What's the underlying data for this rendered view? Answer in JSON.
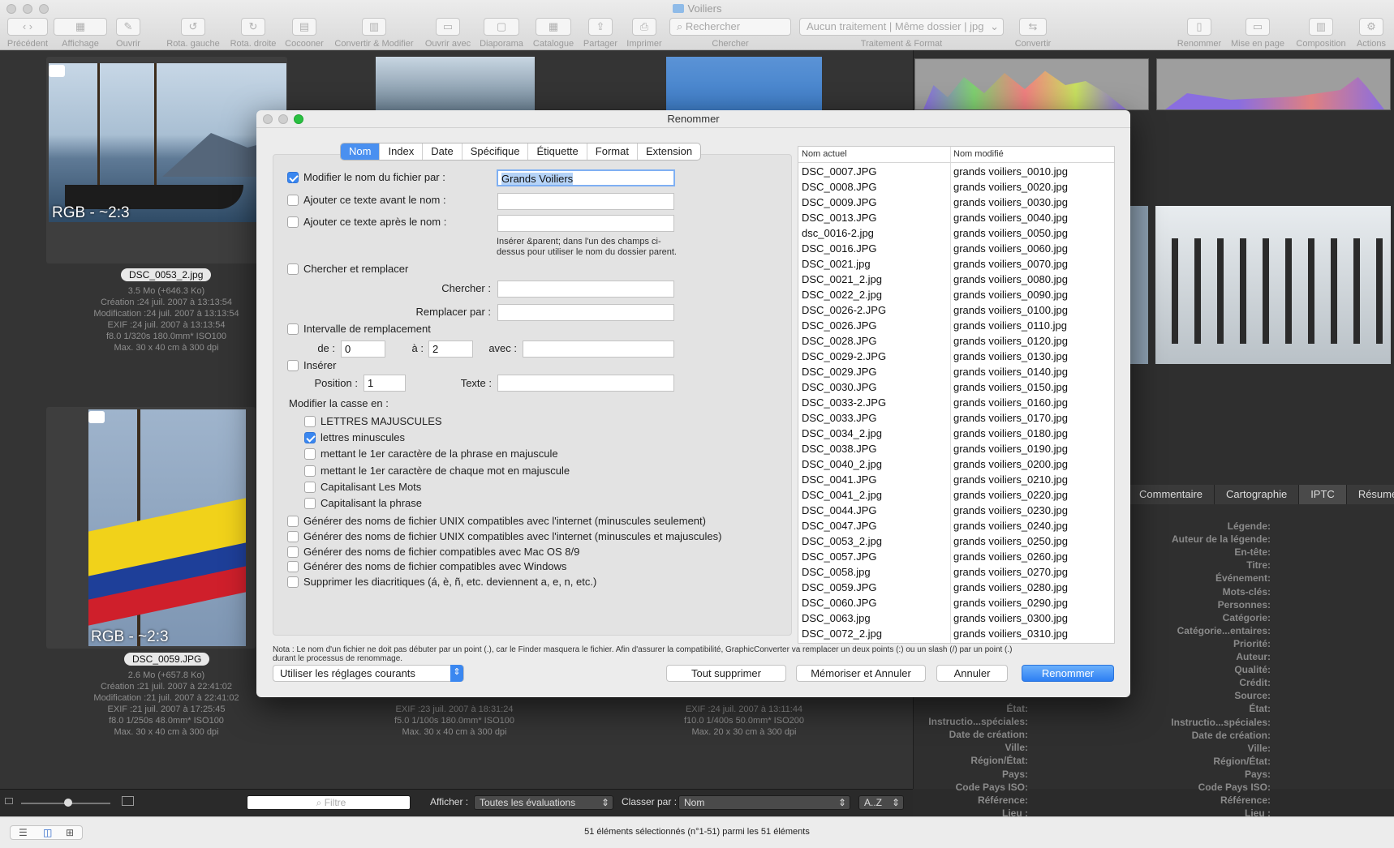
{
  "window": {
    "title": "Voiliers"
  },
  "toolbar": {
    "items": [
      {
        "label": "Précédent",
        "icon": "‹ ›"
      },
      {
        "label": "Affichage",
        "icon": "▦"
      },
      {
        "label": "Ouvrir",
        "icon": "✎"
      },
      {
        "label": "Rota. gauche",
        "icon": "↺"
      },
      {
        "label": "Rota. droite",
        "icon": "↻"
      },
      {
        "label": "Cocooner",
        "icon": "▤"
      },
      {
        "label": "Convertir & Modifier",
        "icon": "▥"
      },
      {
        "label": "Ouvrir avec",
        "icon": "▭"
      },
      {
        "label": "Diaporama",
        "icon": "▢"
      },
      {
        "label": "Catalogue",
        "icon": "▦"
      },
      {
        "label": "Partager",
        "icon": "⇪"
      },
      {
        "label": "Imprimer",
        "icon": "⎙"
      }
    ],
    "search_placeholder": "Rechercher",
    "search_label": "Chercher",
    "process_value": "Aucun traitement | Même dossier | jpg",
    "process_label": "Traitement & Format",
    "convert_label": "Convertir",
    "right_items": [
      {
        "label": "Renommer",
        "icon": "▯"
      },
      {
        "label": "Mise en page",
        "icon": "▭"
      },
      {
        "label": "Composition",
        "icon": "▥"
      },
      {
        "label": "Actions",
        "icon": "⚙"
      }
    ]
  },
  "thumbs": [
    {
      "overlay": "RGB - ~2:3",
      "filename": "DSC_0053_2.jpg",
      "meta": [
        "3.5  Mo (+646.3 Ko)",
        "Création :24 juil. 2007 à 13:13:54",
        "Modification :24 juil. 2007 à 13:13:54",
        "EXIF :24 juil. 2007 à 13:13:54",
        "f8.0 1/320s 180.0mm* ISO100",
        "Max. 30 x 40 cm à 300 dpi"
      ]
    },
    {
      "overlay": "RGB - ~2:3",
      "filename": "DSC_0059.JPG",
      "meta": [
        "2.6  Mo (+657.8 Ko)",
        "Création :21 juil. 2007 à 22:41:02",
        "Modification :21 juil. 2007 à 22:41:02",
        "EXIF :21 juil. 2007 à 17:25:45",
        "f8.0 1/250s 48.0mm* ISO100",
        "Max. 30 x 40 cm à 300 dpi"
      ]
    },
    {
      "meta": [
        "EXIF :23 juil. 2007 à 18:31:24",
        "f5.0 1/100s 180.0mm* ISO100",
        "Max. 30 x 40 cm à 300 dpi"
      ]
    },
    {
      "meta": [
        "EXIF :24 juil. 2007 à 13:11:44",
        "f10.0 1/400s 50.0mm* ISO200",
        "Max. 20 x 30 cm à 300 dpi"
      ]
    }
  ],
  "info_tabs": [
    "Commentaire",
    "Cartographie",
    "IPTC",
    "Résumé"
  ],
  "iptc_labels": [
    "Légende:",
    "Auteur de la légende:",
    "En-tête:",
    "Titre:",
    "Événement:",
    "Mots-clés:",
    "Personnes:",
    "Catégorie:",
    "Catégorie...entaires:",
    "Priorité:",
    "Auteur:",
    "Qualité:",
    "Crédit:",
    "Source:",
    "État:",
    "Instructio...spéciales:",
    "Date de création:",
    "Ville:",
    "Région/État:",
    "Pays:",
    "Code Pays ISO:",
    "Référence:",
    "Lieu :"
  ],
  "iptc_left_labels": [
    "État:",
    "Instructio...spéciales:",
    "Date de création:",
    "Ville:",
    "Région/État:",
    "Pays:",
    "Code Pays ISO:",
    "Référence:",
    "Lieu :"
  ],
  "bottom": {
    "filter_placeholder": "Filtre",
    "show_label": "Afficher :",
    "show_value": "Toutes les évaluations",
    "sort_label": "Classer par :",
    "sort_value": "Nom",
    "order_value": "A..Z"
  },
  "status": "51 éléments sélectionnés (n°1-51) parmi les 51 éléments",
  "dialog": {
    "title": "Renommer",
    "tabs": [
      "Nom",
      "Index",
      "Date",
      "Spécifique",
      "Étiquette",
      "Format",
      "Extension"
    ],
    "modify_name": {
      "label": "Modifier le nom du fichier par :",
      "value": "Grands Voiliers",
      "checked": true
    },
    "before_label": "Ajouter ce texte avant le nom :",
    "after_label": "Ajouter ce texte après le nom :",
    "parent_hint": "Insérer &parent; dans l'un des champs ci-dessus pour utiliser le nom du dossier parent.",
    "search_replace_label": "Chercher et remplacer",
    "search_label": "Chercher :",
    "replace_label": "Remplacer par :",
    "interval_label": "Intervalle de remplacement",
    "from_label": "de :",
    "from_value": "0",
    "to_label": "à :",
    "to_value": "2",
    "with_label": "avec :",
    "insert_label": "Insérer",
    "position_label": "Position :",
    "position_value": "1",
    "text_label": "Texte :",
    "case_title": "Modifier la casse en :",
    "case_options": [
      {
        "label": "LETTRES MAJUSCULES",
        "checked": false
      },
      {
        "label": "lettres minuscules",
        "checked": true
      },
      {
        "label": "mettant le 1er caractère de la phrase en majuscule",
        "checked": false
      },
      {
        "label": "mettant le 1er caractère de chaque mot en majuscule",
        "checked": false
      },
      {
        "label": "Capitalisant Les Mots",
        "checked": false
      },
      {
        "label": "Capitalisant la phrase",
        "checked": false
      }
    ],
    "compat_options": [
      "Générer des noms de fichier UNIX compatibles avec l'internet (minuscules seulement)",
      "Générer des noms de fichier UNIX compatibles avec l'internet (minuscules et majuscules)",
      "Générer des noms de fichier compatibles avec Mac OS 8/9",
      "Générer des noms de fichier compatibles avec Windows",
      "Supprimer les diacritiques (á, è, ñ, etc. deviennent a, e, n, etc.)"
    ],
    "note": "Nota : Le nom d'un fichier ne doit pas débuter par un point (.), car le Finder masquera le fichier. Afin d'assurer la compatibilité, GraphicConverter va remplacer un deux points (:) ou un slash (/) par un point (.) durant le processus de renommage.",
    "settings_value": "Utiliser les réglages courants",
    "buttons": {
      "clear": "Tout supprimer",
      "save_cancel": "Mémoriser et Annuler",
      "cancel": "Annuler",
      "rename": "Renommer"
    },
    "list_headers": [
      "Nom actuel",
      "Nom modifié"
    ],
    "rows": [
      [
        "DSC_0007.JPG",
        "grands voiliers_0010.jpg"
      ],
      [
        "DSC_0008.JPG",
        "grands voiliers_0020.jpg"
      ],
      [
        "DSC_0009.JPG",
        "grands voiliers_0030.jpg"
      ],
      [
        "DSC_0013.JPG",
        "grands voiliers_0040.jpg"
      ],
      [
        "dsc_0016-2.jpg",
        "grands voiliers_0050.jpg"
      ],
      [
        "DSC_0016.JPG",
        "grands voiliers_0060.jpg"
      ],
      [
        "DSC_0021.jpg",
        "grands voiliers_0070.jpg"
      ],
      [
        "DSC_0021_2.jpg",
        "grands voiliers_0080.jpg"
      ],
      [
        "DSC_0022_2.jpg",
        "grands voiliers_0090.jpg"
      ],
      [
        "DSC_0026-2.JPG",
        "grands voiliers_0100.jpg"
      ],
      [
        "DSC_0026.JPG",
        "grands voiliers_0110.jpg"
      ],
      [
        "DSC_0028.JPG",
        "grands voiliers_0120.jpg"
      ],
      [
        "DSC_0029-2.JPG",
        "grands voiliers_0130.jpg"
      ],
      [
        "DSC_0029.JPG",
        "grands voiliers_0140.jpg"
      ],
      [
        "DSC_0030.JPG",
        "grands voiliers_0150.jpg"
      ],
      [
        "DSC_0033-2.JPG",
        "grands voiliers_0160.jpg"
      ],
      [
        "DSC_0033.JPG",
        "grands voiliers_0170.jpg"
      ],
      [
        "DSC_0034_2.jpg",
        "grands voiliers_0180.jpg"
      ],
      [
        "DSC_0038.JPG",
        "grands voiliers_0190.jpg"
      ],
      [
        "DSC_0040_2.jpg",
        "grands voiliers_0200.jpg"
      ],
      [
        "DSC_0041.JPG",
        "grands voiliers_0210.jpg"
      ],
      [
        "DSC_0041_2.jpg",
        "grands voiliers_0220.jpg"
      ],
      [
        "DSC_0044.JPG",
        "grands voiliers_0230.jpg"
      ],
      [
        "DSC_0047.JPG",
        "grands voiliers_0240.jpg"
      ],
      [
        "DSC_0053_2.jpg",
        "grands voiliers_0250.jpg"
      ],
      [
        "DSC_0057.JPG",
        "grands voiliers_0260.jpg"
      ],
      [
        "DSC_0058.jpg",
        "grands voiliers_0270.jpg"
      ],
      [
        "DSC_0059.JPG",
        "grands voiliers_0280.jpg"
      ],
      [
        "DSC_0060.JPG",
        "grands voiliers_0290.jpg"
      ],
      [
        "DSC_0063.jpg",
        "grands voiliers_0300.jpg"
      ],
      [
        "DSC_0072_2.jpg",
        "grands voiliers_0310.jpg"
      ]
    ]
  }
}
